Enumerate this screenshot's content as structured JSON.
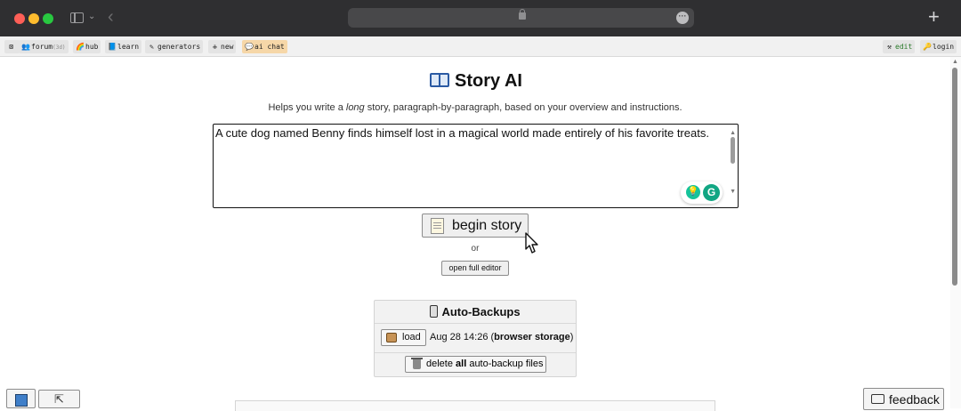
{
  "browser": {
    "bookmarks_left": [
      {
        "icon": "⊠",
        "label": ""
      },
      {
        "icon": "👥",
        "label": "forum",
        "badge": "(3d)"
      },
      {
        "icon": "🌈",
        "label": "hub",
        "badge": ""
      },
      {
        "icon": "📘",
        "label": "learn",
        "badge": ""
      },
      {
        "icon": "✎",
        "label": "generators",
        "badge": ""
      },
      {
        "icon": "✙",
        "label": "new",
        "badge": ""
      },
      {
        "icon": "💬",
        "label": "ai chat",
        "badge": ""
      }
    ],
    "bookmarks_right": [
      {
        "icon": "⚒",
        "label": "edit"
      },
      {
        "icon": "🔑",
        "label": "login"
      }
    ]
  },
  "page": {
    "title": "Story AI",
    "subtitle_pre": "Helps you write a ",
    "subtitle_em": "long",
    "subtitle_post": " story, paragraph-by-paragraph, based on your overview and instructions.",
    "overview_text": "A cute dog named Benny finds himself lost in a magical world made entirely of his favorite treats.",
    "begin_label": "begin story",
    "or_label": "or",
    "open_editor_label": "open full editor"
  },
  "backups": {
    "title": "Auto-Backups",
    "load_label": "load",
    "entry_date": "Aug 28 14:26 (",
    "entry_storage": "browser storage",
    "entry_close": ")",
    "delete_pre": "delete ",
    "delete_bold": "all",
    "delete_post": " auto-backup files"
  },
  "footer": {
    "collapse_label": "⇱",
    "feedback_label": "feedback"
  },
  "colors": {
    "titlebar": "#2f2f31",
    "accent_ai_chat": "#f6d7a8",
    "grammarly": "#15c39a"
  }
}
